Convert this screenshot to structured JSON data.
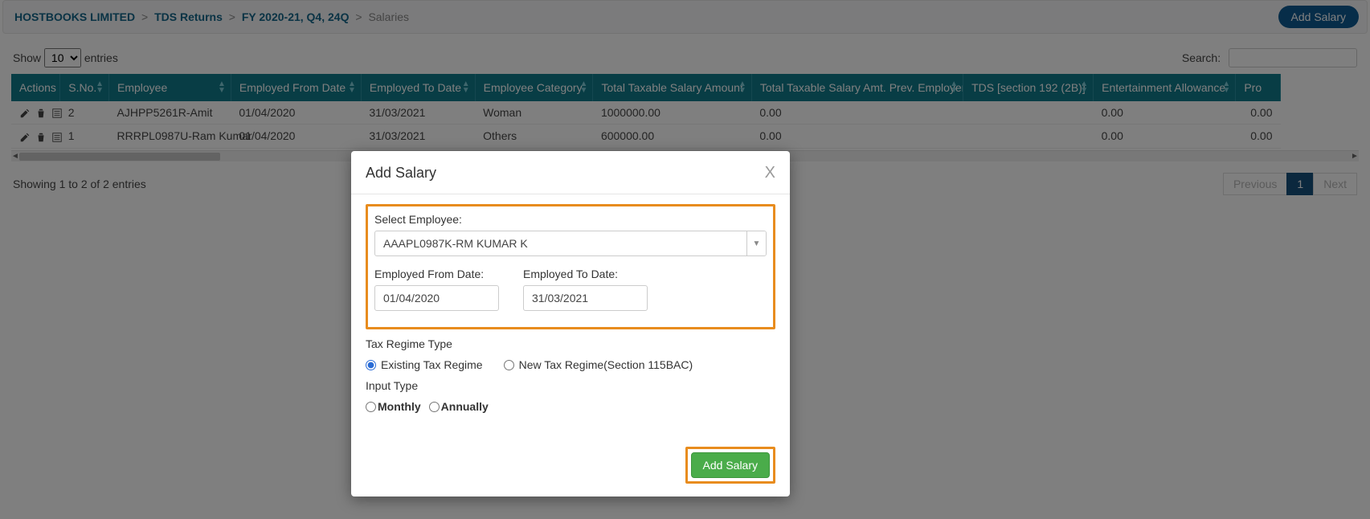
{
  "breadcrumb": {
    "items": [
      "HOSTBOOKS LIMITED",
      "TDS Returns",
      "FY 2020-21, Q4, 24Q",
      "Salaries"
    ],
    "sep": ">"
  },
  "header": {
    "add_salary_button": "Add Salary"
  },
  "controls": {
    "show_label_pre": "Show",
    "show_value": "10",
    "show_label_post": "entries",
    "search_label": "Search:",
    "search_value": ""
  },
  "columns": [
    "Actions",
    "S.No.",
    "Employee",
    "Employed From Date",
    "Employed To Date",
    "Employee Category",
    "Total Taxable Salary Amount",
    "Total Taxable Salary Amt. Prev. Employer",
    "TDS [section 192 (2B)]",
    "Entertainment Allowance",
    "Pro"
  ],
  "rows": [
    {
      "sno": "2",
      "employee": "AJHPP5261R-Amit",
      "from": "01/04/2020",
      "to": "31/03/2021",
      "cat": "Woman",
      "tts": "1000000.00",
      "ttp": "0.00",
      "tds": "",
      "ent": "0.00",
      "pro": "0.00"
    },
    {
      "sno": "1",
      "employee": "RRRPL0987U-Ram Kumar",
      "from": "01/04/2020",
      "to": "31/03/2021",
      "cat": "Others",
      "tts": "600000.00",
      "ttp": "0.00",
      "tds": "",
      "ent": "0.00",
      "pro": "0.00"
    }
  ],
  "footer": {
    "info": "Showing 1 to 2 of 2 entries",
    "prev": "Previous",
    "page": "1",
    "next": "Next"
  },
  "modal": {
    "title": "Add Salary",
    "close": "X",
    "select_label": "Select Employee:",
    "select_value": "AAAPL0987K-RM KUMAR K",
    "from_label": "Employed From Date:",
    "from_value": "01/04/2020",
    "to_label": "Employed To Date:",
    "to_value": "31/03/2021",
    "tax_regime_label": "Tax Regime Type",
    "tax_regime_existing": "Existing Tax Regime",
    "tax_regime_new": "New Tax Regime(Section 115BAC)",
    "input_type_label": "Input Type",
    "input_type_monthly": "Monthly",
    "input_type_annually": "Annually",
    "submit": "Add Salary"
  },
  "colors": {
    "teal": "#117a8b",
    "orange": "#e88c1e",
    "green": "#4aac4a",
    "blue": "#0f5b93",
    "navy": "#16507c"
  }
}
